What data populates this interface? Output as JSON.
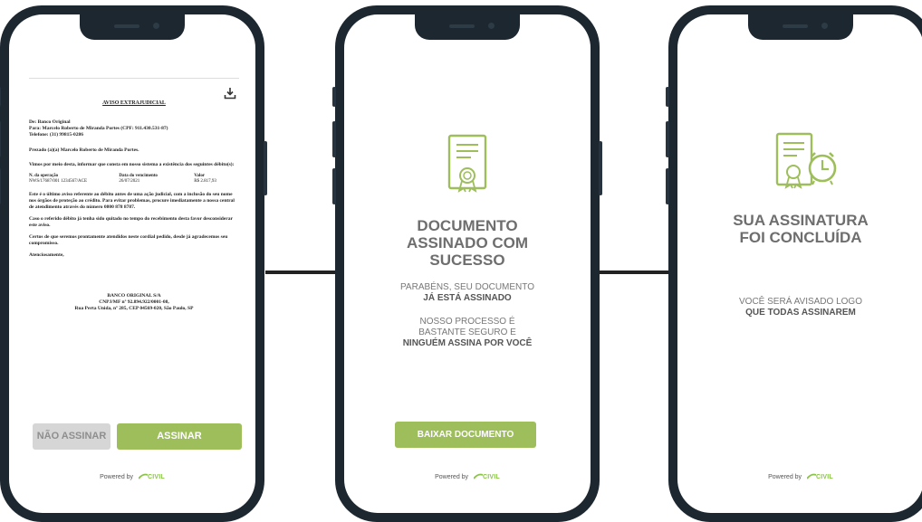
{
  "colors": {
    "phone_frame": "#1c2730",
    "accent_green": "#9dbe5b",
    "disabled_gray": "#d6d6d6"
  },
  "screen1": {
    "download_icon": "download-icon",
    "doc_title": "AVISO EXTRAJUDICIAL",
    "doc_from": "De: Banco Original",
    "doc_to": "Para: Marcelo Roberto de Miranda Portes (CPF: 911.430.531-87)",
    "doc_phone": "Telefone: (31) 99815-0286",
    "doc_greeting": "Prezado (a)(a) Marcelo Roberto de Miranda Portes.",
    "doc_p1": "Vimos por meio desta, informar que consta em nosso sistema a existência dos seguintes débito(s):",
    "doc_table_h1": "N. da operação",
    "doc_table_h2": "Data do vencimento",
    "doc_table_h3": "Valor",
    "doc_table_v1": "NWS/17687/001 1234567/ACE",
    "doc_table_v2": "26/07/2021",
    "doc_table_v3": "R$ 2.817,93",
    "doc_p2": "Este é o último aviso referente ao débito antes de uma ação judicial, com a inclusão do seu nome nos órgãos de proteção ao crédito. Para evitar problemas, procure imediatamente a nossa central de atendimento através do número 0800 878 8787.",
    "doc_p3": "Caso o referido débito já tenha sido quitado no tempo do recebimento desta favor desconsiderar este aviso.",
    "doc_p4": "Certos de que seremos prontamente atendidos neste cordial pedido, desde já agradecemos seu compromisso.",
    "doc_p5": "Atenciosamente,",
    "doc_sign1": "BANCO ORIGINAL S/A",
    "doc_sign2": "CNPJ/MF nº 92.894.922/0001-08,",
    "doc_sign3": "Rua Perta Unida, nº 285, CEP 04569-020, São Paulo, SP",
    "decline_label": "NÃO ASSINAR",
    "sign_label": "ASSINAR",
    "powered_by": "Powered by",
    "logo_text": "CIVIL"
  },
  "screen2": {
    "icon": "signed-certificate-icon",
    "title_l1": "DOCUMENTO",
    "title_l2": "ASSINADO COM",
    "title_l3": "SUCESSO",
    "msg1_l1": "PARABÉNS, SEU DOCUMENTO",
    "msg1_l2": "JÁ ESTÁ ASSINADO",
    "msg2_l1": "NOSSO PROCESSO É",
    "msg2_l2": "BASTANTE SEGURO E",
    "msg2_l3": "NINGUÉM ASSINA POR VOCÊ",
    "download_label": "BAIXAR DOCUMENTO",
    "powered_by": "Powered by",
    "logo_text": "CIVIL"
  },
  "screen3": {
    "icon": "certificate-clock-icon",
    "title_l1": "SUA ASSINATURA",
    "title_l2": "FOI CONCLUÍDA",
    "msg_l1": "VOCÊ SERÁ AVISADO LOGO",
    "msg_l2": "QUE TODAS ASSINAREM",
    "powered_by": "Powered by",
    "logo_text": "CIVIL"
  }
}
